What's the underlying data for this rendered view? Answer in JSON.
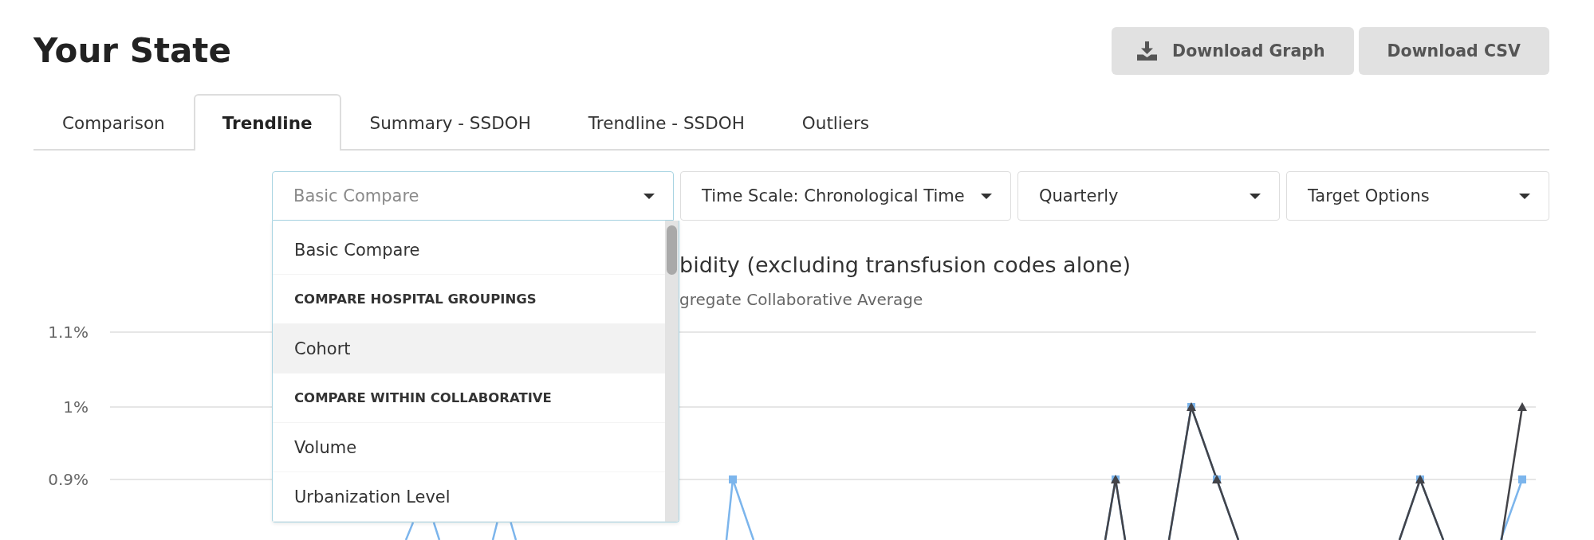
{
  "page": {
    "title": "Your State"
  },
  "actions": [
    {
      "kind": "icon_text",
      "label": "Download Graph"
    },
    {
      "kind": "text",
      "label": "Download CSV"
    }
  ],
  "tabs": [
    {
      "label": "Comparison",
      "selected": false
    },
    {
      "label": "Trendline",
      "selected": true
    },
    {
      "label": "Summary - SSDOH",
      "selected": false
    },
    {
      "label": "Trendline - SSDOH",
      "selected": false
    },
    {
      "label": "Outliers",
      "selected": false
    }
  ],
  "filters": [
    {
      "value": "Basic Compare",
      "open": true,
      "menu": [
        {
          "kind": "option",
          "label": "Basic Compare",
          "focused": false
        },
        {
          "kind": "heading",
          "label": "COMPARE HOSPITAL GROUPINGS",
          "focused": false
        },
        {
          "kind": "option",
          "label": "Cohort",
          "focused": true
        },
        {
          "kind": "heading",
          "label": "COMPARE WITHIN COLLABORATIVE",
          "focused": false
        },
        {
          "kind": "option",
          "label": "Volume",
          "focused": false
        },
        {
          "kind": "option",
          "label": "Urbanization Level",
          "focused": false
        }
      ]
    },
    {
      "value": "Time Scale: Chronological Time",
      "open": false
    },
    {
      "value": "Quarterly",
      "open": false
    },
    {
      "value": "Target Options",
      "open": false
    }
  ],
  "chart": {
    "title": "bidity (excluding transfusion codes alone)",
    "subtitle": "gregate Collaborative Average",
    "y_axis_labels": [
      "1.1%",
      "1%",
      "0.9%"
    ]
  }
}
